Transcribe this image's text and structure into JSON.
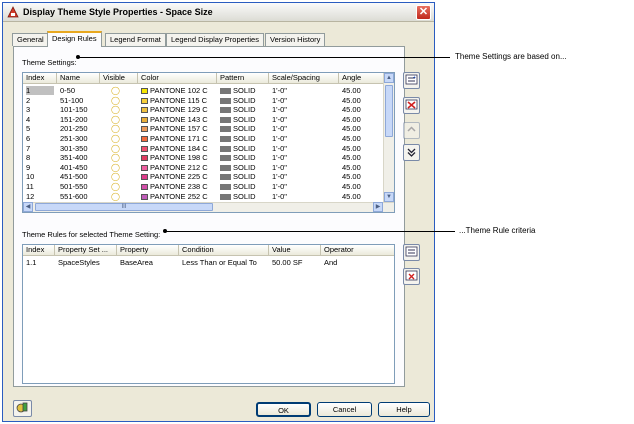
{
  "window": {
    "title": "Display Theme Style Properties - Space Size",
    "close_label": "✕"
  },
  "tabs": [
    {
      "label": "General"
    },
    {
      "label": "Design Rules"
    },
    {
      "label": "Legend Format"
    },
    {
      "label": "Legend Display Properties"
    },
    {
      "label": "Version History"
    }
  ],
  "theme_settings": {
    "label": "Theme Settings:",
    "columns": [
      "Index",
      "Name",
      "Visible",
      "Color",
      "Pattern",
      "Scale/Spacing",
      "Angle"
    ],
    "rows": [
      {
        "index": "1",
        "name": "0-50",
        "color": "PANTONE 102 C",
        "swatch": "#f6e600",
        "pattern": "SOLID",
        "scale": "1'-0\"",
        "angle": "45.00"
      },
      {
        "index": "2",
        "name": "51-100",
        "color": "PANTONE 115 C",
        "swatch": "#f7cf3a",
        "pattern": "SOLID",
        "scale": "1'-0\"",
        "angle": "45.00"
      },
      {
        "index": "3",
        "name": "101-150",
        "color": "PANTONE 129 C",
        "swatch": "#efc042",
        "pattern": "SOLID",
        "scale": "1'-0\"",
        "angle": "45.00"
      },
      {
        "index": "4",
        "name": "151-200",
        "color": "PANTONE 143 C",
        "swatch": "#eaae3a",
        "pattern": "SOLID",
        "scale": "1'-0\"",
        "angle": "45.00"
      },
      {
        "index": "5",
        "name": "201-250",
        "color": "PANTONE 157 C",
        "swatch": "#ec9a5a",
        "pattern": "SOLID",
        "scale": "1'-0\"",
        "angle": "45.00"
      },
      {
        "index": "6",
        "name": "251-300",
        "color": "PANTONE 171 C",
        "swatch": "#f26a3c",
        "pattern": "SOLID",
        "scale": "1'-0\"",
        "angle": "45.00"
      },
      {
        "index": "7",
        "name": "301-350",
        "color": "PANTONE 184 C",
        "swatch": "#f0506e",
        "pattern": "SOLID",
        "scale": "1'-0\"",
        "angle": "45.00"
      },
      {
        "index": "8",
        "name": "351-400",
        "color": "PANTONE 198 C",
        "swatch": "#e03c62",
        "pattern": "SOLID",
        "scale": "1'-0\"",
        "angle": "45.00"
      },
      {
        "index": "9",
        "name": "401-450",
        "color": "PANTONE 212 C",
        "swatch": "#ee5fa0",
        "pattern": "SOLID",
        "scale": "1'-0\"",
        "angle": "45.00"
      },
      {
        "index": "10",
        "name": "451-500",
        "color": "PANTONE 225 C",
        "swatch": "#dd3b8a",
        "pattern": "SOLID",
        "scale": "1'-0\"",
        "angle": "45.00"
      },
      {
        "index": "11",
        "name": "501-550",
        "color": "PANTONE 238 C",
        "swatch": "#d24fa8",
        "pattern": "SOLID",
        "scale": "1'-0\"",
        "angle": "45.00"
      },
      {
        "index": "12",
        "name": "551-600",
        "color": "PANTONE 252 C",
        "swatch": "#c05cb8",
        "pattern": "SOLID",
        "scale": "1'-0\"",
        "angle": "45.00"
      }
    ],
    "hscroll_grip": "III"
  },
  "theme_rules": {
    "label": "Theme Rules for selected Theme Setting:",
    "columns": [
      "Index",
      "Property Set ...",
      "Property",
      "Condition",
      "Value",
      "Operator"
    ],
    "rows": [
      {
        "index": "1.1",
        "property_set": "SpaceStyles",
        "property": "BaseArea",
        "condition": "Less Than or Equal To",
        "value": "50.00 SF",
        "operator": "And"
      }
    ]
  },
  "buttons": {
    "ok": "OK",
    "cancel": "Cancel",
    "help": "Help"
  },
  "callouts": {
    "settings": "Theme Settings are based on...",
    "rules": "...Theme Rule criteria"
  },
  "icons": {
    "add": "add-setting-icon",
    "remove": "remove-setting-icon",
    "up": "move-up-icon",
    "down": "move-down-icon"
  }
}
